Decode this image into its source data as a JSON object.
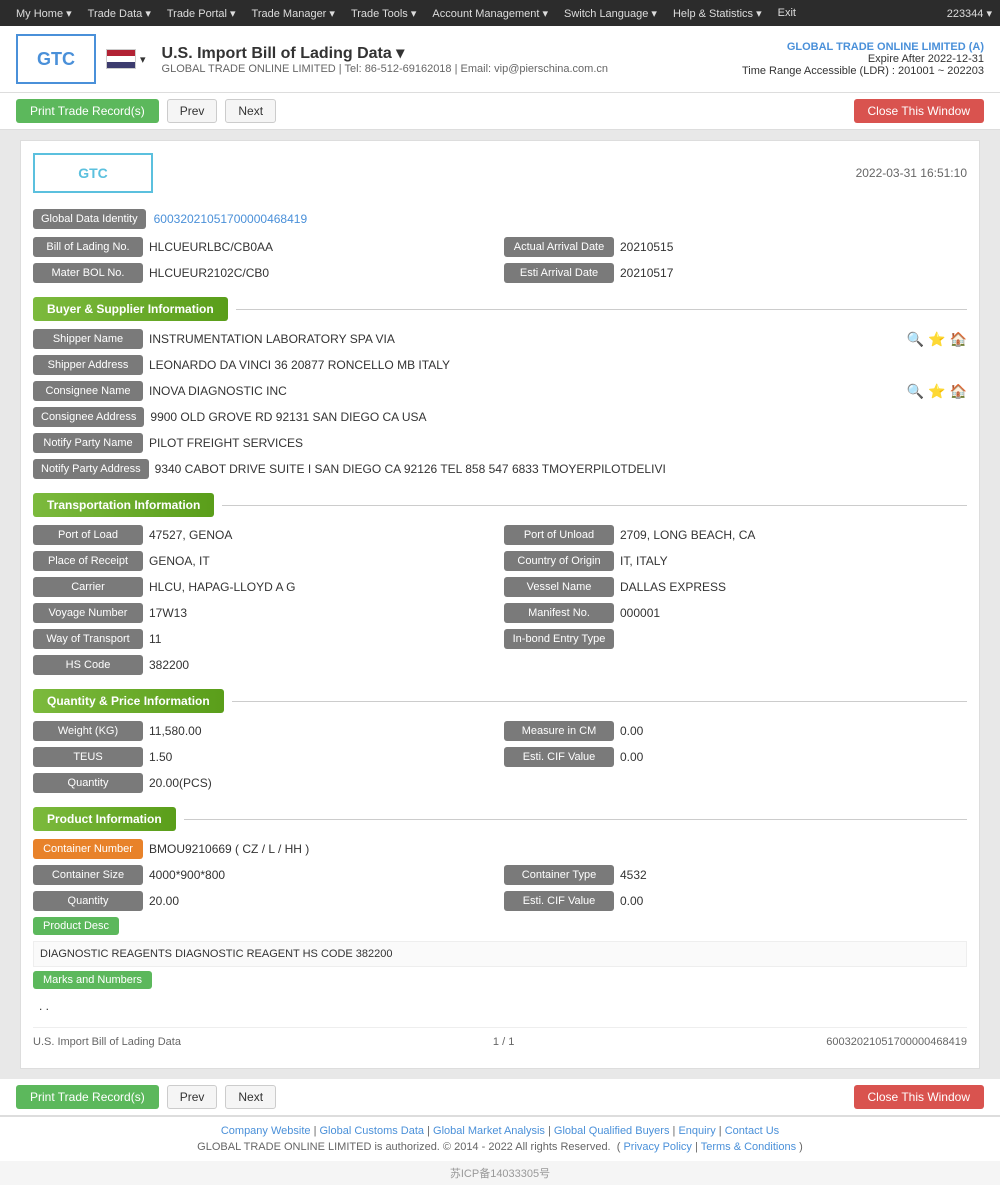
{
  "topnav": {
    "items": [
      {
        "label": "My Home ▾",
        "name": "my-home"
      },
      {
        "label": "Trade Data ▾",
        "name": "trade-data"
      },
      {
        "label": "Trade Portal ▾",
        "name": "trade-portal"
      },
      {
        "label": "Trade Manager ▾",
        "name": "trade-manager"
      },
      {
        "label": "Trade Tools ▾",
        "name": "trade-tools"
      },
      {
        "label": "Account Management ▾",
        "name": "account-management"
      },
      {
        "label": "Switch Language ▾",
        "name": "switch-language"
      },
      {
        "label": "Help & Statistics ▾",
        "name": "help-statistics"
      },
      {
        "label": "Exit",
        "name": "exit"
      }
    ],
    "user_id": "223344 ▾"
  },
  "header": {
    "logo": "GTC",
    "title": "U.S. Import Bill of Lading Data ▾",
    "subtitle": "GLOBAL TRADE ONLINE LIMITED | Tel: 86-512-69162018 | Email: vip@pierschina.com.cn",
    "company_name": "GLOBAL TRADE ONLINE LIMITED (A)",
    "expire_label": "Expire After 2022-12-31",
    "time_range": "Time Range Accessible (LDR) : 201001 ~ 202203"
  },
  "toolbar": {
    "print_label": "Print Trade Record(s)",
    "prev_label": "Prev",
    "next_label": "Next",
    "close_label": "Close This Window"
  },
  "record": {
    "date": "2022-03-31 16:51:10",
    "logo": "GTC",
    "global_data_identity": {
      "label": "Global Data Identity",
      "value": "60032021051700000468419"
    },
    "bill_of_lading": {
      "label": "Bill of Lading No.",
      "value": "HLCUEURLBC/CB0AA"
    },
    "actual_arrival_date": {
      "label": "Actual Arrival Date",
      "value": "20210515"
    },
    "mater_bol": {
      "label": "Mater BOL No.",
      "value": "HLCUEUR2102C/CB0"
    },
    "esti_arrival_date": {
      "label": "Esti Arrival Date",
      "value": "20210517"
    },
    "buyer_supplier": {
      "section_title": "Buyer & Supplier Information",
      "shipper_name": {
        "label": "Shipper Name",
        "value": "INSTRUMENTATION LABORATORY SPA VIA"
      },
      "shipper_address": {
        "label": "Shipper Address",
        "value": "LEONARDO DA VINCI 36 20877 RONCELLO MB ITALY"
      },
      "consignee_name": {
        "label": "Consignee Name",
        "value": "INOVA DIAGNOSTIC INC"
      },
      "consignee_address": {
        "label": "Consignee Address",
        "value": "9900 OLD GROVE RD 92131 SAN DIEGO CA USA"
      },
      "notify_party_name": {
        "label": "Notify Party Name",
        "value": "PILOT FREIGHT SERVICES"
      },
      "notify_party_address": {
        "label": "Notify Party Address",
        "value": "9340 CABOT DRIVE SUITE I SAN DIEGO CA 92126 TEL 858 547 6833 TMOYERPILOTDELIVI"
      }
    },
    "transportation": {
      "section_title": "Transportation Information",
      "port_of_load": {
        "label": "Port of Load",
        "value": "47527, GENOA"
      },
      "port_of_unload": {
        "label": "Port of Unload",
        "value": "2709, LONG BEACH, CA"
      },
      "place_of_receipt": {
        "label": "Place of Receipt",
        "value": "GENOA, IT"
      },
      "country_of_origin": {
        "label": "Country of Origin",
        "value": "IT, ITALY"
      },
      "carrier": {
        "label": "Carrier",
        "value": "HLCU, HAPAG-LLOYD A G"
      },
      "vessel_name": {
        "label": "Vessel Name",
        "value": "DALLAS EXPRESS"
      },
      "voyage_number": {
        "label": "Voyage Number",
        "value": "17W13"
      },
      "manifest_no": {
        "label": "Manifest No.",
        "value": "000001"
      },
      "way_of_transport": {
        "label": "Way of Transport",
        "value": "11"
      },
      "in_bond_entry_type": {
        "label": "In-bond Entry Type",
        "value": ""
      },
      "hs_code": {
        "label": "HS Code",
        "value": "382200"
      }
    },
    "quantity_price": {
      "section_title": "Quantity & Price Information",
      "weight_kg": {
        "label": "Weight (KG)",
        "value": "11,580.00"
      },
      "measure_in_cm": {
        "label": "Measure in CM",
        "value": "0.00"
      },
      "teus": {
        "label": "TEUS",
        "value": "1.50"
      },
      "esti_cif_value": {
        "label": "Esti. CIF Value",
        "value": "0.00"
      },
      "quantity": {
        "label": "Quantity",
        "value": "20.00(PCS)"
      }
    },
    "product": {
      "section_title": "Product Information",
      "container_number": {
        "label": "Container Number",
        "value": "BMOU9210669 ( CZ / L / HH )"
      },
      "container_size": {
        "label": "Container Size",
        "value": "4000*900*800"
      },
      "container_type": {
        "label": "Container Type",
        "value": "4532"
      },
      "quantity": {
        "label": "Quantity",
        "value": "20.00"
      },
      "esti_cif_value": {
        "label": "Esti. CIF Value",
        "value": "0.00"
      },
      "product_desc_label": "Product Desc",
      "product_desc_value": "DIAGNOSTIC REAGENTS DIAGNOSTIC REAGENT HS CODE 382200",
      "marks_label": "Marks and Numbers",
      "marks_value": ". ."
    },
    "footer": {
      "page_label": "U.S. Import Bill of Lading Data",
      "page_number": "1 / 1",
      "record_id": "60032021051700000468419"
    }
  },
  "bottom_toolbar": {
    "print_label": "Print Trade Record(s)",
    "prev_label": "Prev",
    "next_label": "Next",
    "close_label": "Close This Window"
  },
  "page_footer": {
    "links": [
      {
        "label": "Company Website",
        "name": "company-website"
      },
      {
        "label": "Global Customs Data",
        "name": "global-customs-data"
      },
      {
        "label": "Global Market Analysis",
        "name": "global-market-analysis"
      },
      {
        "label": "Global Qualified Buyers",
        "name": "global-qualified-buyers"
      },
      {
        "label": "Enquiry",
        "name": "enquiry"
      },
      {
        "label": "Contact Us",
        "name": "contact-us"
      }
    ],
    "copyright": "GLOBAL TRADE ONLINE LIMITED is authorized. © 2014 - 2022 All rights Reserved.",
    "privacy_label": "Privacy Policy",
    "terms_label": "Terms & Conditions"
  },
  "icp": {
    "value": "苏ICP备14033305号"
  }
}
